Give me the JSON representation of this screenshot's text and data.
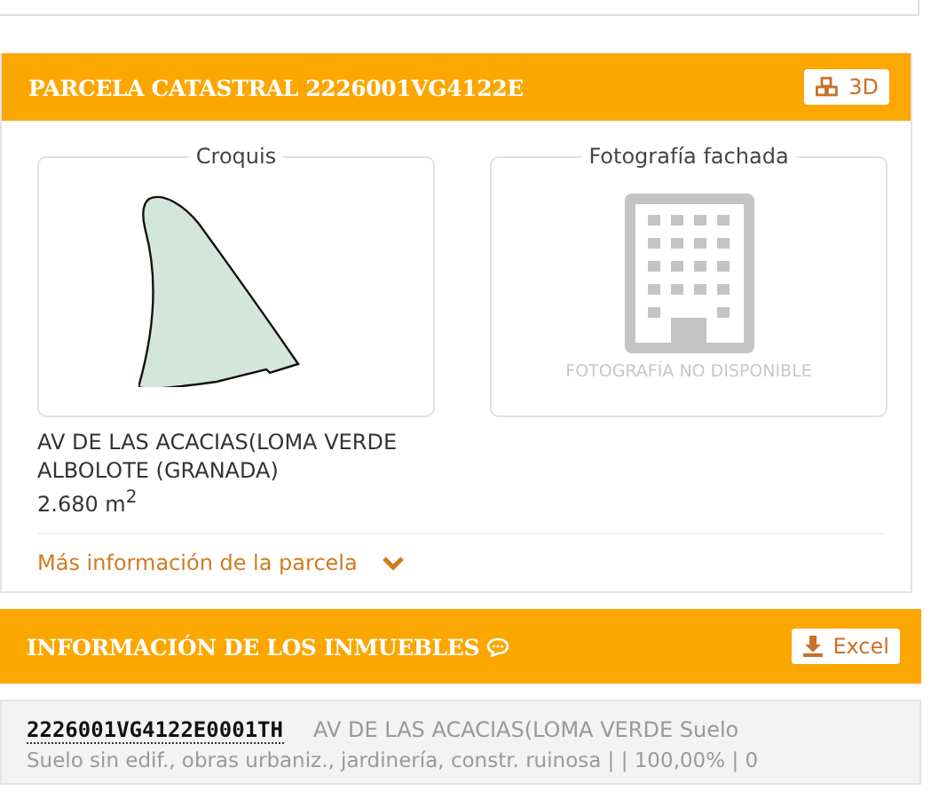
{
  "parcel_panel": {
    "title": "PARCELA CATASTRAL 2226001VG4122E",
    "button_3d": "3D",
    "sketch": {
      "legend": "Croquis"
    },
    "photo": {
      "legend": "Fotografía fachada",
      "placeholder_text": "FOTOGRAFÍA NO DISPONIBLE"
    },
    "address_lines": [
      "AV DE LAS ACACIAS(LOMA VERDE",
      "ALBOLOTE (GRANADA)"
    ],
    "area": "2.680 m$^{2}$",
    "more_info_link": {
      "label": "Más información de la parcela",
      "expanded": false
    }
  },
  "properties_panel": {
    "title": "INFORMACIÓN DE LOS INMUEBLES",
    "excel_button": "Excel",
    "rows": [
      {
        "reference": "2226001VG4122E0001TH",
        "address": "AV DE LAS ACACIAS(LOMA VERDE Suelo",
        "details": "Suelo sin edif., obras urbaniz., jardinería, constr. ruinosa | | 100,00% | 0"
      }
    ]
  }
}
